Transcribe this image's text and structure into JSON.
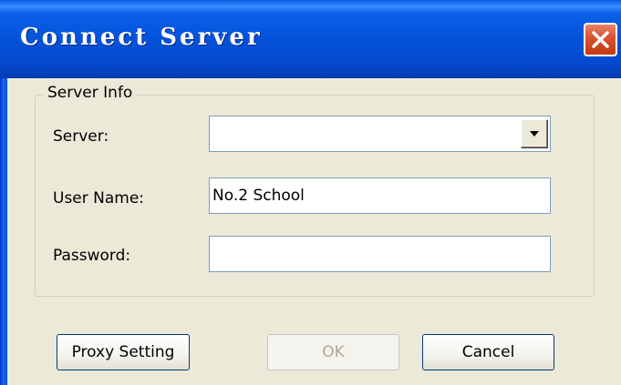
{
  "window": {
    "title": "Connect Server"
  },
  "group": {
    "legend": "Server Info"
  },
  "fields": {
    "server_label": "Server:",
    "server_value": "",
    "username_label": "User Name:",
    "username_value": "No.2 School",
    "password_label": "Password:",
    "password_value": ""
  },
  "buttons": {
    "proxy_label": "Proxy Setting",
    "ok_label": "OK",
    "cancel_label": "Cancel"
  },
  "icons": {
    "close": "close-icon",
    "dropdown": "chevron-down-icon"
  },
  "colors": {
    "titlebar": "#0452d9",
    "close_button": "#d9512c",
    "face": "#ece9d8"
  }
}
